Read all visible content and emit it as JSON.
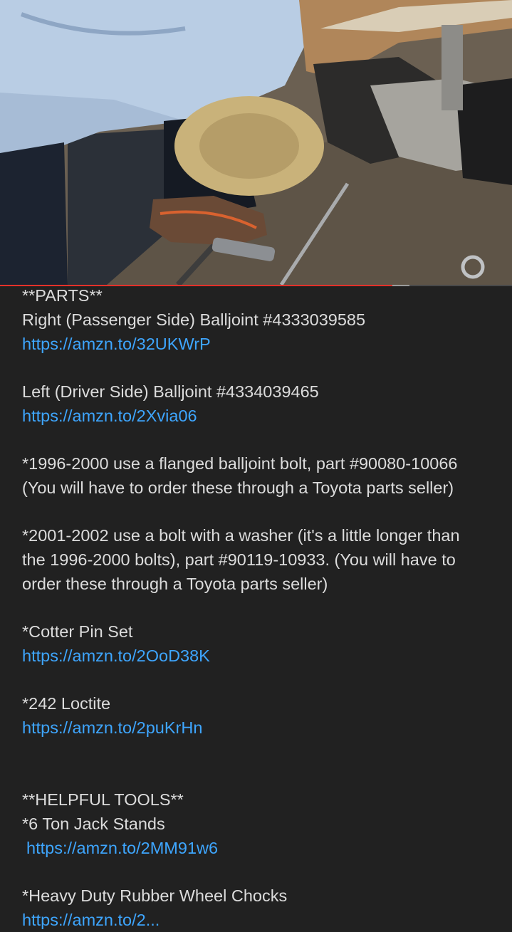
{
  "video": {
    "progress_fraction": 0.767,
    "buffered_fraction": 0.8,
    "played_color": "#e4312a"
  },
  "description": {
    "parts_heading": "**PARTS**",
    "right_balljoint": "Right (Passenger Side) Balljoint #4333039585",
    "right_link": "https://amzn.to/32UKWrP",
    "left_balljoint": "Left (Driver Side) Balljoint #4334039465",
    "left_link": "https://amzn.to/2Xvia06",
    "note_1996_line1": "*1996-2000 use a flanged balljoint bolt, part #90080-10066",
    "note_1996_line2": "(You will have to order these through a Toyota parts seller)",
    "note_2001_line1": "*2001-2002 use a bolt with a washer (it's a little longer than",
    "note_2001_line2": "the 1996-2000 bolts), part #90119-10933.  (You will have to",
    "note_2001_line3": "order these through a Toyota parts seller)",
    "cotter_pin": "*Cotter Pin Set",
    "cotter_link": "https://amzn.to/2OoD38K",
    "loctite": "*242 Loctite",
    "loctite_link": "https://amzn.to/2puKrHn",
    "tools_heading": "**HELPFUL TOOLS**",
    "jack_stands": "*6 Ton Jack Stands",
    "jack_link": "https://amzn.to/2MM91w6",
    "wheel_chocks": "*Heavy Duty Rubber Wheel Chocks",
    "chocks_link": "https://amzn.to/2..."
  }
}
